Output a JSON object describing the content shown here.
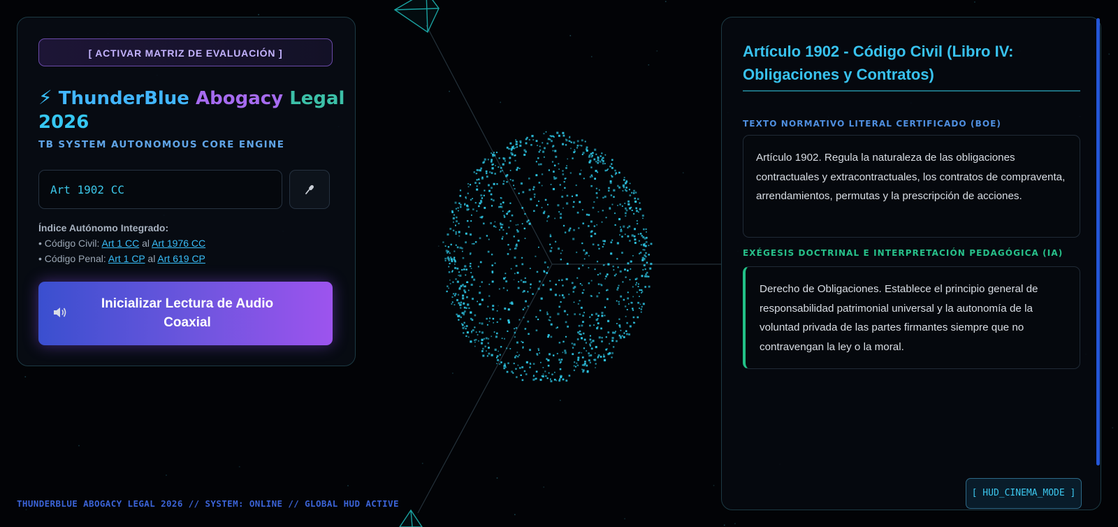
{
  "left_panel": {
    "matrix_button_label": "[ ACTIVAR MATRIZ DE EVALUACIÓN ]",
    "brand": {
      "icon": "lightning-bolt-icon",
      "word1": "ThunderBlue",
      "word2": "Abogacy",
      "word3": "Legal",
      "word4": "2026"
    },
    "subtitle": "TB SYSTEM AUTONOMOUS CORE ENGINE",
    "search": {
      "value": "Art 1902 CC",
      "placeholder": ""
    },
    "mic_icon": "microphone-icon",
    "index": {
      "title": "Índice Autónomo Integrado:",
      "civil": {
        "prefix": "• Código Civil: ",
        "from": "Art 1 CC",
        "joiner": " al ",
        "to": "Art 1976 CC"
      },
      "penal": {
        "prefix": "• Código Penal: ",
        "from": "Art 1 CP",
        "joiner": " al ",
        "to": "Art 619 CP"
      }
    },
    "audio_button": {
      "icon": "speaker-icon",
      "label": "Inicializar Lectura de Audio Coaxial"
    }
  },
  "right_panel": {
    "title": "Artículo 1902 - Código Civil (Libro IV: Obligaciones y Contratos)",
    "section1_label": "TEXTO NORMATIVO LITERAL CERTIFICADO (BOE)",
    "section1_text": "Artículo 1902. Regula la naturaleza de las obligaciones contractuales y extracontractuales, los contratos de compraventa, arrendamientos, permutas y la prescripción de acciones.",
    "section2_label": "EXÉGESIS DOCTRINAL E INTERPRETACIÓN PEDAGÓGICA (IA)",
    "section2_text": "Derecho de Obligaciones. Establece el principio general de responsabilidad patrimonial universal y la autonomía de la voluntad privada de las partes firmantes siempre que no contravengan la ley o la moral."
  },
  "hud_button_label": "[ HUD_CINEMA_MODE ]",
  "status_bar": "THUNDERBLUE ABOGACY LEGAL 2026 // SYSTEM: ONLINE // GLOBAL HUD ACTIVE",
  "colors": {
    "background": "#020306",
    "accent_cyan": "#38bdf8",
    "accent_purple": "#9d54ee",
    "accent_green": "#22c187",
    "particle": "#2ec7e6"
  }
}
